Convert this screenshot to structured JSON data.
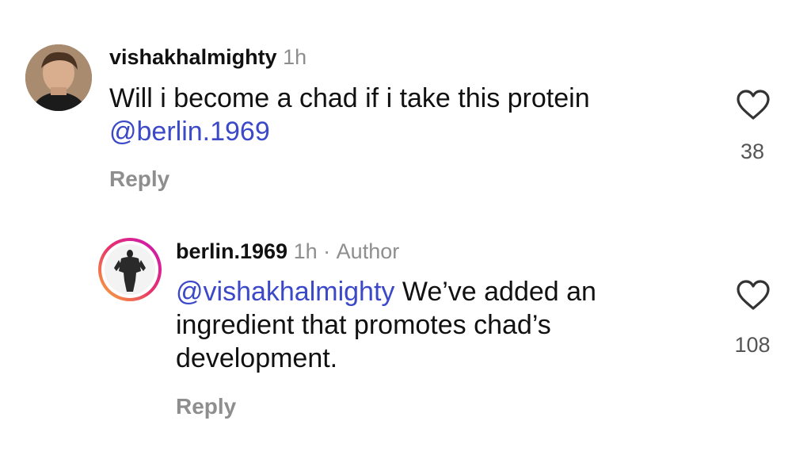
{
  "comments": [
    {
      "username": "vishakhalmighty",
      "time": "1h",
      "author_badge": "",
      "mention": "",
      "text": "Will i become a chad if i take this protein",
      "text_mention_after": "@berlin.1969",
      "reply_label": "Reply",
      "likes": "38",
      "avatar_icon": "profile-photo"
    },
    {
      "username": "berlin.1969",
      "time": "1h",
      "separator": "·",
      "author_badge": "Author",
      "mention": "@vishakhalmighty",
      "text_line1": " We’ve added an",
      "text_line2": "ingredient that promotes chad’s",
      "text_line3": "development.",
      "reply_label": "Reply",
      "likes": "108",
      "avatar_icon": "story-ring-profile-photo"
    }
  ],
  "colors": {
    "mention": "#3b49c9",
    "muted": "#8e8e8e",
    "story_ring_start": "#f9b234",
    "story_ring_end": "#c913b9"
  }
}
